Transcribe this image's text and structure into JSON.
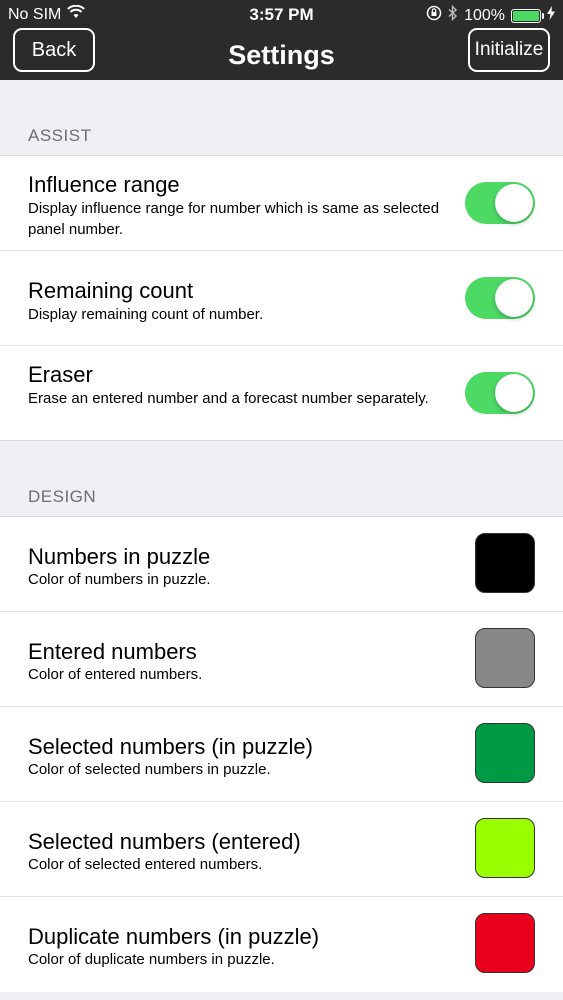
{
  "status_bar": {
    "carrier": "No SIM",
    "time": "3:57 PM",
    "battery_percent": "100%",
    "battery_level": 1.0
  },
  "nav": {
    "back_label": "Back",
    "title": "Settings",
    "initialize_label": "Initialize"
  },
  "sections": {
    "assist": {
      "header": "ASSIST",
      "items": [
        {
          "title": "Influence range",
          "description": "Display influence range for number which is same as selected panel number.",
          "enabled": true
        },
        {
          "title": "Remaining count",
          "description": "Display remaining count of number.",
          "enabled": true
        },
        {
          "title": "Eraser",
          "description": "Erase an entered number and a forecast number separately.",
          "enabled": true
        }
      ]
    },
    "design": {
      "header": "DESIGN",
      "items": [
        {
          "title": "Numbers in puzzle",
          "description": "Color of numbers in puzzle.",
          "color": "#000000"
        },
        {
          "title": "Entered numbers",
          "description": "Color of entered numbers.",
          "color": "#888888"
        },
        {
          "title": "Selected numbers (in puzzle)",
          "description": "Color of selected numbers in puzzle.",
          "color": "#009a44"
        },
        {
          "title": "Selected numbers (entered)",
          "description": "Color of selected entered numbers.",
          "color": "#99ff00"
        },
        {
          "title": "Duplicate numbers (in puzzle)",
          "description": "Color of duplicate numbers in puzzle.",
          "color": "#e8001c"
        }
      ]
    }
  },
  "colors": {
    "toggle_on": "#4cd964",
    "nav_background": "#2b2b2b"
  }
}
